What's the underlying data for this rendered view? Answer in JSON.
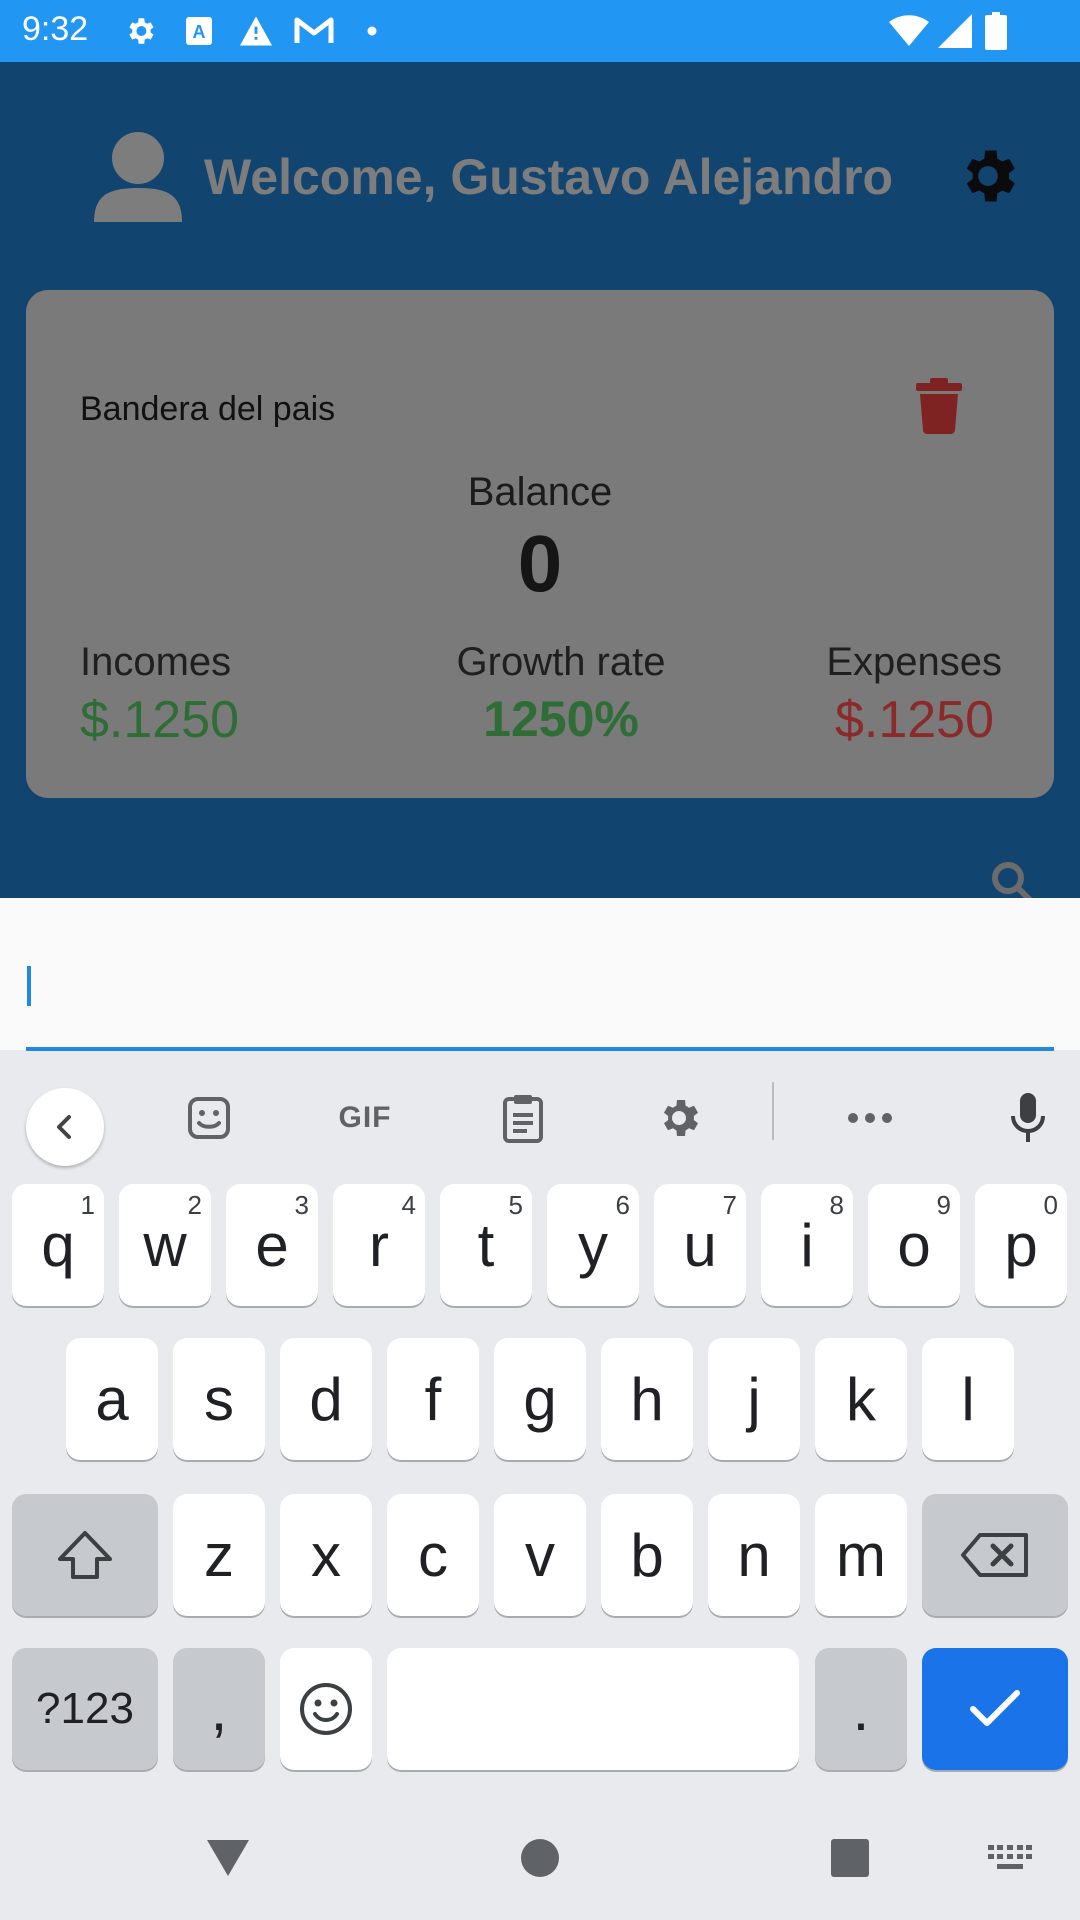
{
  "status_bar": {
    "time": "9:32",
    "icons": [
      "settings-icon",
      "text-a-icon",
      "warning-icon",
      "gmail-icon",
      "dot-icon",
      "wifi-icon",
      "signal-icon",
      "battery-icon"
    ]
  },
  "header": {
    "welcome": "Welcome, Gustavo Alejandro"
  },
  "card": {
    "flag_label": "Bandera del pais",
    "balance_label": "Balance",
    "balance_value": "0",
    "incomes_label": "Incomes",
    "incomes_value": "$.1250",
    "growth_label": "Growth rate",
    "growth_value": "1250%",
    "expenses_label": "Expenses",
    "expenses_value": "$.1250"
  },
  "search": {
    "value": ""
  },
  "keyboard": {
    "toolbar": [
      "back-icon",
      "sticker-icon",
      "GIF",
      "clipboard-icon",
      "gear-icon",
      "more-icon",
      "microphone-icon"
    ],
    "row1": [
      {
        "k": "q",
        "h": "1"
      },
      {
        "k": "w",
        "h": "2"
      },
      {
        "k": "e",
        "h": "3"
      },
      {
        "k": "r",
        "h": "4"
      },
      {
        "k": "t",
        "h": "5"
      },
      {
        "k": "y",
        "h": "6"
      },
      {
        "k": "u",
        "h": "7"
      },
      {
        "k": "i",
        "h": "8"
      },
      {
        "k": "o",
        "h": "9"
      },
      {
        "k": "p",
        "h": "0"
      }
    ],
    "row2": [
      "a",
      "s",
      "d",
      "f",
      "g",
      "h",
      "j",
      "k",
      "l"
    ],
    "row3": [
      "z",
      "x",
      "c",
      "v",
      "b",
      "n",
      "m"
    ],
    "symbols_key": "?123",
    "comma_key": ",",
    "period_key": "."
  },
  "colors": {
    "status_bar": "#2196f3",
    "app_bg": "#124470",
    "accent": "#1a73e8",
    "income": "#2f6d36",
    "expense": "#8b2a2a"
  }
}
